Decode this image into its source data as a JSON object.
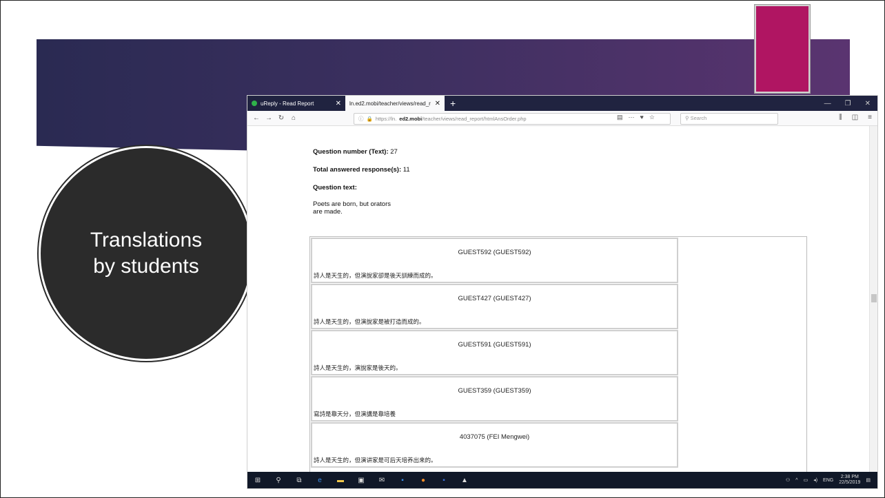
{
  "slide": {
    "title": "Translations by students",
    "accent_color": "#b01562"
  },
  "browser": {
    "tabs": [
      {
        "label": "uReply - Read Report"
      },
      {
        "label": "ln.ed2.mobi/teacher/views/read_r"
      }
    ],
    "url_prefix": "https://ln.",
    "url_domain": "ed2.mobi",
    "url_rest": "/teacher/views/read_report/htmlAnsOrder.php",
    "search_placeholder": "Search"
  },
  "report": {
    "question_number_label": "Question number (Text):",
    "question_number": "27",
    "total_label": "Total answered response(s):",
    "total": "11",
    "question_text_label": "Question text:",
    "question_text_line1": "Poets are born, but orators",
    "question_text_line2": "are made.",
    "responses": [
      {
        "name": "GUEST592 (GUEST592)",
        "answer": "詩人是天生的，但演說家卻是後天訓練而成的。"
      },
      {
        "name": "GUEST427 (GUEST427)",
        "answer": "詩人是天生的，但演說家是被打造而成的。"
      },
      {
        "name": "GUEST591 (GUEST591)",
        "answer": "詩人是天生的，演說家是後天的。"
      },
      {
        "name": "GUEST359 (GUEST359)",
        "answer": "寫詩是靠天分，但演講是靠培養"
      },
      {
        "name": "4037075 (FEI Mengwei)",
        "answer": "詩人是天生的，但演讲家是可后天培养出来的。"
      }
    ]
  },
  "taskbar": {
    "lang": "ENG",
    "time": "2:38 PM",
    "date": "22/5/2019"
  }
}
